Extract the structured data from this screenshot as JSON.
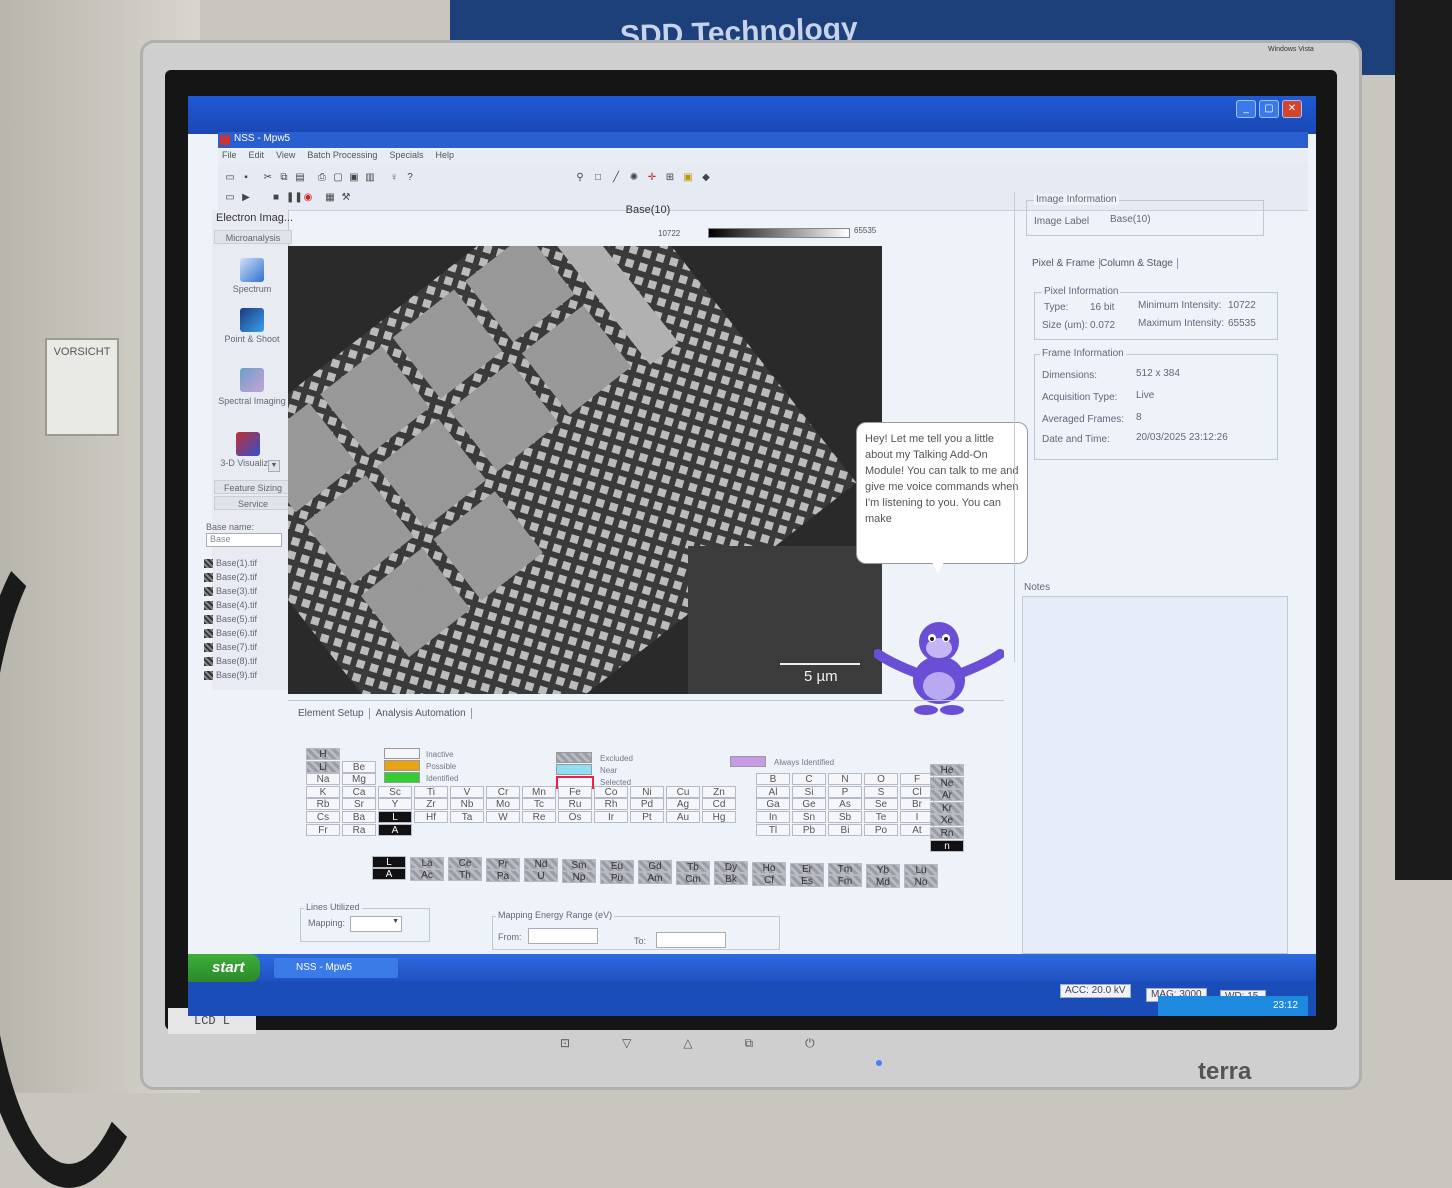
{
  "environment": {
    "poster_text": "SDD Technology",
    "wall_sign": "VORSICHT",
    "monitor_label": "LCD L",
    "monitor_brand": "terra",
    "os_badge": "Windows Vista"
  },
  "window": {
    "title": "NSS - Mpw5",
    "buttons": {
      "minimize": "_",
      "maximize": "▢",
      "close": "✕"
    }
  },
  "menu": [
    "File",
    "Edit",
    "View",
    "Batch Processing",
    "Specials",
    "Help"
  ],
  "leftnav": {
    "header": "Electron Imag...",
    "microanalysis": "Microanalysis",
    "tools": [
      {
        "label": "Spectrum",
        "color": "#2f6fd0"
      },
      {
        "label": "Point & Shoot",
        "color": "#1a3a7a"
      },
      {
        "label": "Spectral Imaging",
        "color": "#6aa0c8"
      },
      {
        "label": "3-D Visualizat",
        "color": "#c03030"
      }
    ],
    "feature_sizing": "Feature Sizing",
    "service": "Service",
    "base_name_label": "Base name:",
    "base_name_value": "Base",
    "files": [
      "Base(1).tif",
      "Base(2).tif",
      "Base(3).tif",
      "Base(4).tif",
      "Base(5).tif",
      "Base(6).tif",
      "Base(7).tif",
      "Base(8).tif",
      "Base(9).tif"
    ]
  },
  "image": {
    "title": "Base(10)",
    "min_intensity": "10722",
    "max_intensity": "65535",
    "scale_bar": "5 µm"
  },
  "assistant": {
    "message": "Hey! Let me tell you a little about my Talking Add-On Module! You can talk to me and give me voice commands when I'm listening to you. You can make"
  },
  "info": {
    "image_information": "Image Information",
    "image_label_key": "Image Label",
    "image_label_value": "Base(10)",
    "tabs": [
      "Pixel & Frame",
      "Column & Stage"
    ],
    "pixel_information": "Pixel Information",
    "type_key": "Type:",
    "type_value": "16 bit",
    "size_key": "Size (um):",
    "size_value": "0.072",
    "min_key": "Minimum Intensity:",
    "min_value": "10722",
    "max_key": "Maximum Intensity:",
    "max_value": "65535",
    "frame_information": "Frame Information",
    "dimensions_key": "Dimensions:",
    "dimensions_value": "512 x 384",
    "acq_key": "Acquisition Type:",
    "acq_value": "Live",
    "avg_key": "Averaged Frames:",
    "avg_value": "8",
    "date_key": "Date and Time:",
    "date_value": "20/03/2025 23:12:26",
    "notes": "Notes"
  },
  "element_setup": {
    "tabs": [
      "Element Setup",
      "Analysis Automation"
    ],
    "legend": {
      "inactive": "Inactive",
      "possible": "Possible",
      "identified": "Identified",
      "excluded": "Excluded",
      "near": "Near",
      "selected": "Selected",
      "always": "Always Identified"
    },
    "legend_colors": {
      "inactive": "#f4f6fa",
      "possible": "#e8a317",
      "identified": "#33cc33",
      "excluded": "#9a9da3",
      "near": "#8fe0f5",
      "selected": "#f4f6fa",
      "always": "#c79be6"
    },
    "lines_utilized": "Lines Utilized",
    "mapping": "Mapping:",
    "energy_range": "Mapping Energy Range (eV)",
    "from": "From:",
    "to": "To:"
  },
  "taskbar": {
    "start": "start",
    "task": "NSS - Mpw5",
    "acc": "ACC: 20.0 kV",
    "mag": "MAG: 3000",
    "wd": "WD: 15.",
    "clock": "23:12"
  }
}
